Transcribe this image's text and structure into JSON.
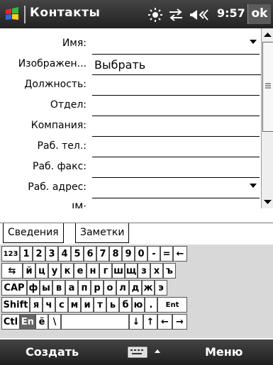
{
  "titlebar": {
    "title": "Контакты",
    "time": "9:57",
    "ok": "ok"
  },
  "form": {
    "fields": [
      {
        "label": "Имя:",
        "value": ""
      },
      {
        "label": "Изображен...",
        "value": "Выбрать"
      },
      {
        "label": "Должность:",
        "value": ""
      },
      {
        "label": "Отдел:",
        "value": ""
      },
      {
        "label": "Компания:",
        "value": ""
      },
      {
        "label": "Раб. тел.:",
        "value": ""
      },
      {
        "label": "Раб. факс:",
        "value": ""
      },
      {
        "label": "Раб. адрес:",
        "value": ""
      },
      {
        "label": "IM:",
        "value": ""
      }
    ]
  },
  "tabs": {
    "details": "Сведения",
    "notes": "Заметки"
  },
  "keyboard": {
    "row1": [
      "123",
      "1",
      "2",
      "3",
      "4",
      "5",
      "6",
      "7",
      "8",
      "9",
      "0",
      "-",
      "=",
      "←"
    ],
    "row2": [
      "⇆",
      "й",
      "ц",
      "у",
      "к",
      "е",
      "н",
      "г",
      "ш",
      "щ",
      "з",
      "х",
      "ъ"
    ],
    "row3": [
      "CAP",
      "ф",
      "ы",
      "в",
      "а",
      "п",
      "р",
      "о",
      "л",
      "д",
      "ж",
      "э"
    ],
    "row4": [
      "Shift",
      "я",
      "ч",
      "с",
      "м",
      "и",
      "т",
      "ь",
      "б",
      "ю",
      ".",
      "Ent"
    ],
    "row5": [
      "Ctl",
      "En",
      "ё",
      "\\",
      "",
      "↓",
      "↑",
      "←",
      "→"
    ]
  },
  "softkeys": {
    "left": "Создать",
    "right": "Меню"
  }
}
